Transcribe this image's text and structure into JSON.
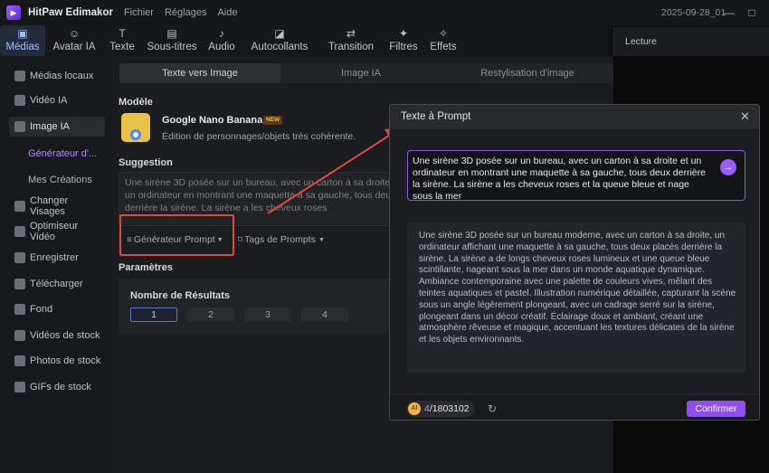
{
  "titlebar": {
    "app_name": "HitPaw Edimakor",
    "menu": [
      "Fichier",
      "Réglages",
      "Aide"
    ],
    "version_date": "2025-09-28_01"
  },
  "tool_tabs": [
    {
      "label": "Médias",
      "icon": "media-icon"
    },
    {
      "label": "Avatar IA",
      "icon": "avatar-icon"
    },
    {
      "label": "Texte",
      "icon": "text-icon"
    },
    {
      "label": "Sous-titres",
      "icon": "subtitles-icon"
    },
    {
      "label": "Audio",
      "icon": "audio-icon"
    },
    {
      "label": "Autocollants",
      "icon": "sticker-icon"
    },
    {
      "label": "Transition",
      "icon": "transition-icon"
    },
    {
      "label": "Filtres",
      "icon": "filter-icon"
    },
    {
      "label": "Effets",
      "icon": "effects-icon"
    }
  ],
  "preview": {
    "title": "Lecture"
  },
  "sidebar": {
    "items": [
      {
        "label": "Médias locaux"
      },
      {
        "label": "Vidéo IA"
      },
      {
        "label": "Image IA"
      },
      {
        "label": "Changer Visages"
      },
      {
        "label": "Optimiseur Vidéo"
      },
      {
        "label": "Enregistrer"
      },
      {
        "label": "Télécharger"
      },
      {
        "label": "Fond"
      },
      {
        "label": "Vidéos de stock"
      },
      {
        "label": "Photos de stock"
      },
      {
        "label": "GIFs de stock"
      }
    ],
    "subitems": [
      {
        "label": "Générateur d'..."
      },
      {
        "label": "Mes Créations"
      }
    ]
  },
  "main": {
    "subtabs": [
      "Texte vers Image",
      "Image IA",
      "Restylisation d'image"
    ],
    "model_label": "Modèle",
    "model_name": "Google Nano Banana",
    "model_badge": "NEW",
    "model_desc": "Édition de personnages/objets très cohérente.",
    "suggestion_label": "Suggestion",
    "suggestion_text": "Une sirène 3D posée sur un bureau, avec un carton à sa droite et un ordinateur en montrant une maquette à sa gauche, tous deux derrière la sirène. La sirène a les cheveux roses",
    "prompt_generator": "Générateur Prompt",
    "prompt_tags": "Tags de Prompts",
    "params_label": "Paramètres",
    "results_label": "Nombre de Résultats",
    "result_counts": [
      "1",
      "2",
      "3",
      "4"
    ]
  },
  "dialog": {
    "title": "Texte à Prompt",
    "input_text": "Une sirène 3D posée sur un bureau, avec un carton à sa droite et un ordinateur en montrant une maquette à sa gauche, tous deux derrière la sirène. La sirène a les cheveux roses et la queue bleue et nage sous la mer",
    "result_text": "Une sirène 3D posée sur un bureau moderne, avec un carton à sa droite, un ordinateur affichant une maquette à sa gauche, tous deux placés derrière la sirène. La sirène a de longs cheveux roses lumineux et une queue bleue scintillante, nageant sous la mer dans un monde aquatique dynamique. Ambiance contemporaine avec une palette de couleurs vives, mêlant des teintes aquatiques et pastel. Illustration numérique détaillée, capturant la scène sous un angle légèrement plongeant, avec un cadrage serré sur la sirène, plongeant dans un décor créatif. Éclairage doux et ambiant, créant une atmosphère rêveuse et magique, accentuant les textures délicates de la sirène et les objets environnants.",
    "credits_used": "4",
    "credits_total": "/1803102",
    "confirm": "Confirmer"
  },
  "colors": {
    "accent_purple": "#8e4fee",
    "highlight_red": "#e0493f",
    "active_blue": "#9fc1ff"
  }
}
